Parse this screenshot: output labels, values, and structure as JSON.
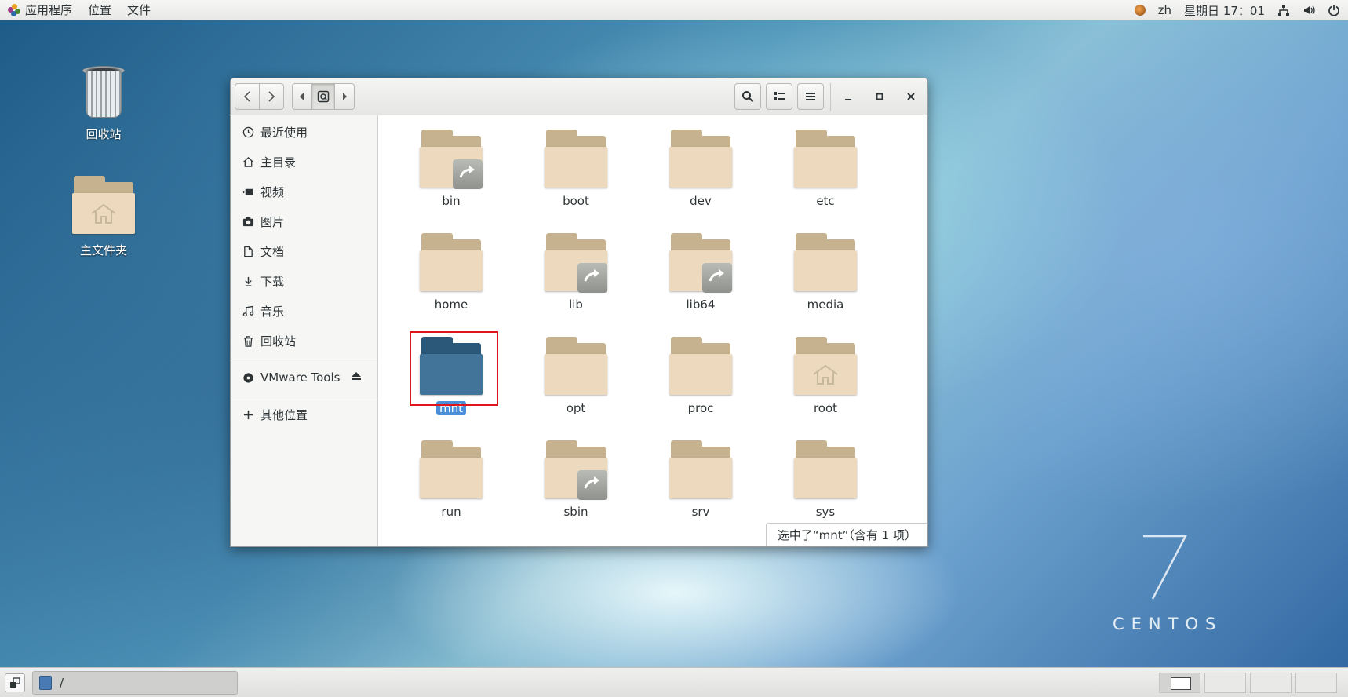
{
  "topbar": {
    "applications": "应用程序",
    "places": "位置",
    "files": "文件",
    "input_method": "zh",
    "clock": "星期日 17：01"
  },
  "desktop": {
    "trash_label": "回收站",
    "home_label": "主文件夹",
    "brand_number": "7",
    "brand_text": "CENTOS"
  },
  "window": {
    "sidebar": {
      "items": [
        {
          "label": "最近使用",
          "icon": "clock-icon"
        },
        {
          "label": "主目录",
          "icon": "home-icon"
        },
        {
          "label": "视频",
          "icon": "video-icon"
        },
        {
          "label": "图片",
          "icon": "camera-icon"
        },
        {
          "label": "文档",
          "icon": "document-icon"
        },
        {
          "label": "下载",
          "icon": "download-icon"
        },
        {
          "label": "音乐",
          "icon": "music-icon"
        },
        {
          "label": "回收站",
          "icon": "trash-icon"
        }
      ],
      "device": "VMware Tools",
      "other_locations": "其他位置"
    },
    "folders": [
      {
        "name": "bin",
        "link": true
      },
      {
        "name": "boot",
        "link": false
      },
      {
        "name": "dev",
        "link": false
      },
      {
        "name": "etc",
        "link": false
      },
      {
        "name": "home",
        "link": false
      },
      {
        "name": "lib",
        "link": true
      },
      {
        "name": "lib64",
        "link": true
      },
      {
        "name": "media",
        "link": false
      },
      {
        "name": "mnt",
        "link": false,
        "selected": true
      },
      {
        "name": "opt",
        "link": false
      },
      {
        "name": "proc",
        "link": false
      },
      {
        "name": "root",
        "link": false,
        "home": true
      },
      {
        "name": "run",
        "link": false
      },
      {
        "name": "sbin",
        "link": true
      },
      {
        "name": "srv",
        "link": false
      },
      {
        "name": "sys",
        "link": false
      }
    ],
    "status": "选中了“mnt”（含有 1 项）"
  },
  "taskbar": {
    "task_label": "/"
  },
  "colors": {
    "selection": "#4a90d9",
    "selected_folder": "#42749a",
    "highlight_box": "#e0151b"
  }
}
